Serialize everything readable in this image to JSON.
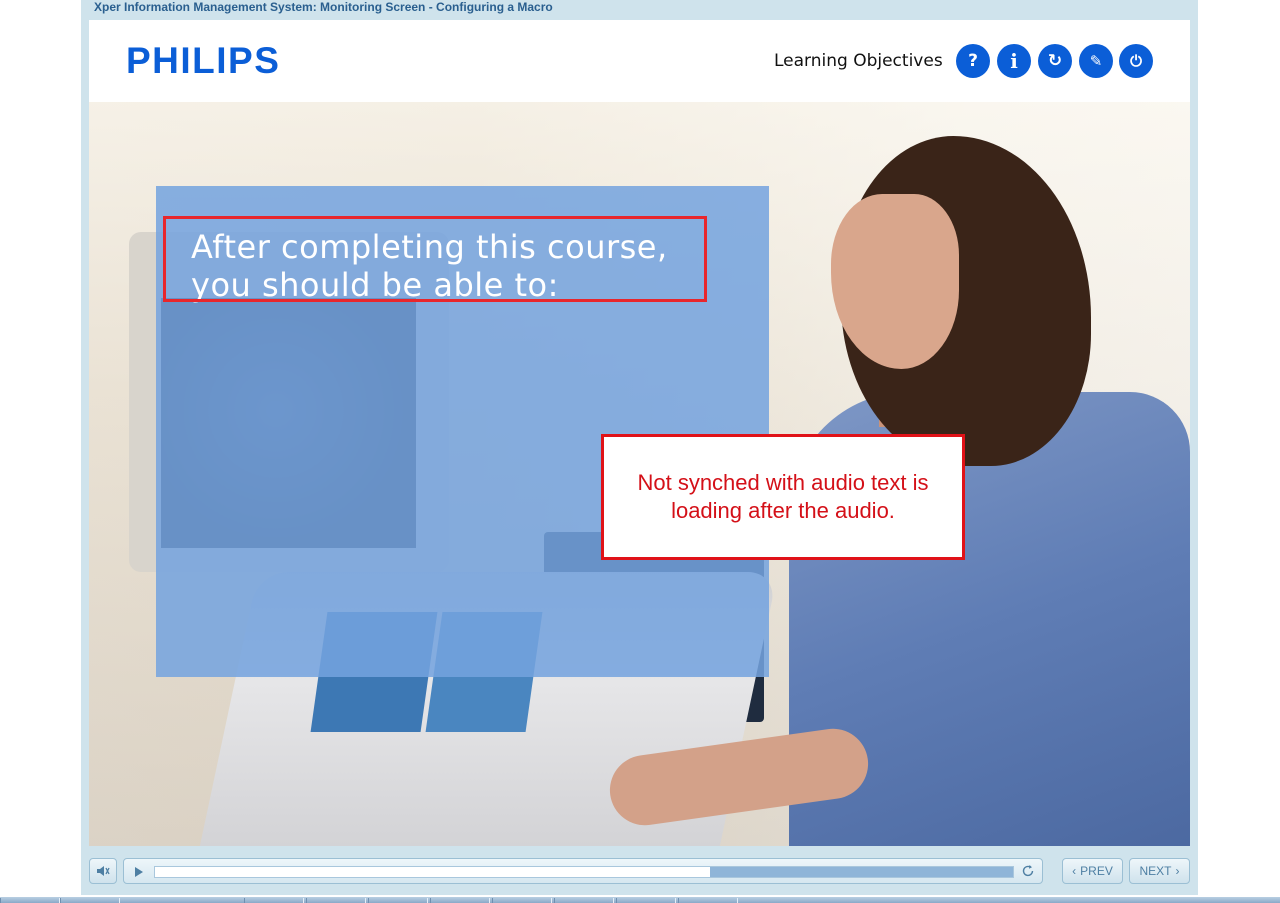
{
  "window": {
    "title": "Xper Information Management System: Monitoring Screen - Configuring a Macro"
  },
  "header": {
    "logo": "PHILIPS",
    "section_label": "Learning Objectives",
    "buttons": [
      {
        "name": "help-button",
        "icon": "question-icon",
        "glyph": "?"
      },
      {
        "name": "info-button",
        "icon": "info-icon",
        "glyph": "i"
      },
      {
        "name": "replay-button",
        "icon": "refresh-icon",
        "glyph": "↻"
      },
      {
        "name": "resources-button",
        "icon": "compass-icon",
        "glyph": "✎"
      },
      {
        "name": "exit-button",
        "icon": "power-icon",
        "glyph": "⏻"
      }
    ]
  },
  "content": {
    "heading": "After completing this course, you should be able to:"
  },
  "callout": {
    "text": "Not synched with audio text is loading after the audio."
  },
  "controls": {
    "mute_icon": "speaker-icon",
    "play_icon": "play-icon",
    "replay_icon": "refresh-icon",
    "progress": 0.647,
    "prev_label": "PREV",
    "next_label": "NEXT"
  },
  "colors": {
    "brand": "#0b5ed7",
    "panel": "#74a3de",
    "annotation": "#e01218"
  }
}
